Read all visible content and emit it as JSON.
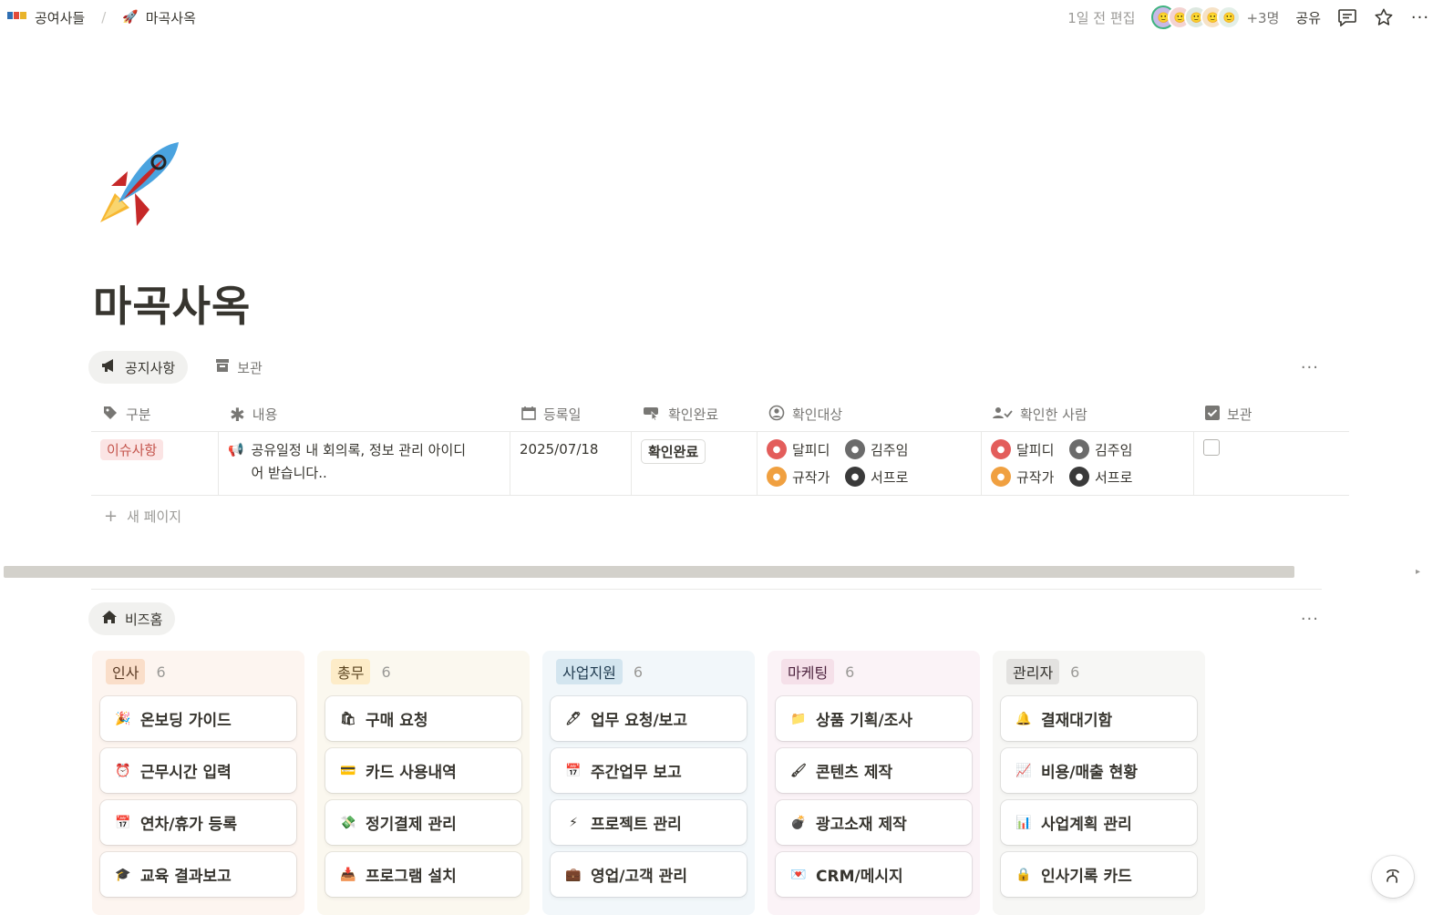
{
  "breadcrumb": {
    "workspace_icon": "workspace-logo",
    "workspace": "공여사들",
    "separator": "/",
    "page_icon": "rocket-icon",
    "page": "마곡사옥"
  },
  "topbar": {
    "edited": "1일 전 편집",
    "more_people": "+3명",
    "share": "공유",
    "comment_icon": "comment-icon",
    "star_icon": "star-icon",
    "more_icon": "more-icon"
  },
  "page": {
    "icon": "rocket-icon",
    "title": "마곡사옥"
  },
  "notice_views": {
    "tabs": [
      {
        "label": "공지사항",
        "icon": "megaphone-icon",
        "active": true
      },
      {
        "label": "보관",
        "icon": "archive-icon",
        "active": false
      }
    ],
    "more": "···"
  },
  "table": {
    "columns": [
      {
        "label": "구분",
        "icon": "tag-icon"
      },
      {
        "label": "내용",
        "icon": "asterisk-icon"
      },
      {
        "label": "등록일",
        "icon": "calendar-icon"
      },
      {
        "label": "확인완료",
        "icon": "button-icon"
      },
      {
        "label": "확인대상",
        "icon": "person-icon"
      },
      {
        "label": "확인한 사람",
        "icon": "people-check-icon"
      },
      {
        "label": "보관",
        "icon": "checkbox-icon"
      }
    ],
    "rows": [
      {
        "category": "이슈사항",
        "content_icon": "megaphone-icon",
        "content_line1": "공유일정 내 회의록, 정보 관리 아이디",
        "content_line2": "어 받습니다..",
        "date": "2025/07/18",
        "confirm_button": "확인완료",
        "targets": [
          "달피디",
          "김주임",
          "규작가",
          "서프로"
        ],
        "confirmed_by": [
          "달피디",
          "김주임",
          "규작가",
          "서프로"
        ],
        "archived": false
      }
    ],
    "new_page": "새 페이지"
  },
  "biz_views": {
    "tab": "비즈홈",
    "tab_icon": "home-icon",
    "more": "···"
  },
  "board": {
    "columns": [
      {
        "name": "인사",
        "count": "6",
        "bg": "#fdf5f0",
        "tag_bg": "#fadec9",
        "tag_color": "#5a3a24",
        "cards": [
          {
            "icon": "party-icon",
            "label": "온보딩 가이드"
          },
          {
            "icon": "alarm-icon",
            "label": "근무시간 입력"
          },
          {
            "icon": "calendar-icon",
            "label": "연차/휴가 등록"
          },
          {
            "icon": "graduation-icon",
            "label": "교육 결과보고"
          }
        ]
      },
      {
        "name": "총무",
        "count": "6",
        "bg": "#fbf8ef",
        "tag_bg": "#fdecc8",
        "tag_color": "#5c4520",
        "cards": [
          {
            "icon": "shopping-icon",
            "label": "구매 요청"
          },
          {
            "icon": "card-icon",
            "label": "카드 사용내역"
          },
          {
            "icon": "money-icon",
            "label": "정기결제 관리"
          },
          {
            "icon": "download-icon",
            "label": "프로그램 설치"
          }
        ]
      },
      {
        "name": "사업지원",
        "count": "6",
        "bg": "#f2f7fa",
        "tag_bg": "#d3e5ef",
        "tag_color": "#1f3a4f",
        "cards": [
          {
            "icon": "pen-icon",
            "label": "업무 요청/보고"
          },
          {
            "icon": "calendar-icon",
            "label": "주간업무 보고"
          },
          {
            "icon": "lightning-icon",
            "label": "프로젝트 관리"
          },
          {
            "icon": "briefcase-icon",
            "label": "영업/고객 관리"
          }
        ]
      },
      {
        "name": "마케팅",
        "count": "6",
        "bg": "#fbf3f7",
        "tag_bg": "#f5e0e9",
        "tag_color": "#4f2540",
        "cards": [
          {
            "icon": "folder-icon",
            "label": "상품 기획/조사"
          },
          {
            "icon": "brush-icon",
            "label": "콘텐츠 제작"
          },
          {
            "icon": "bomb-icon",
            "label": "광고소재 제작"
          },
          {
            "icon": "love-letter-icon",
            "label": "CRM/메시지"
          }
        ]
      },
      {
        "name": "관리자",
        "count": "6",
        "bg": "#f7f7f5",
        "tag_bg": "#e3e2e0",
        "tag_color": "#32302c",
        "cards": [
          {
            "icon": "bell-icon",
            "label": "결재대기함"
          },
          {
            "icon": "chart-up-icon",
            "label": "비용/매출 현황"
          },
          {
            "icon": "bar-chart-icon",
            "label": "사업계획 관리"
          },
          {
            "icon": "lock-icon",
            "label": "인사기록 카드"
          }
        ]
      }
    ]
  },
  "help": {
    "icon": "help-icon"
  }
}
